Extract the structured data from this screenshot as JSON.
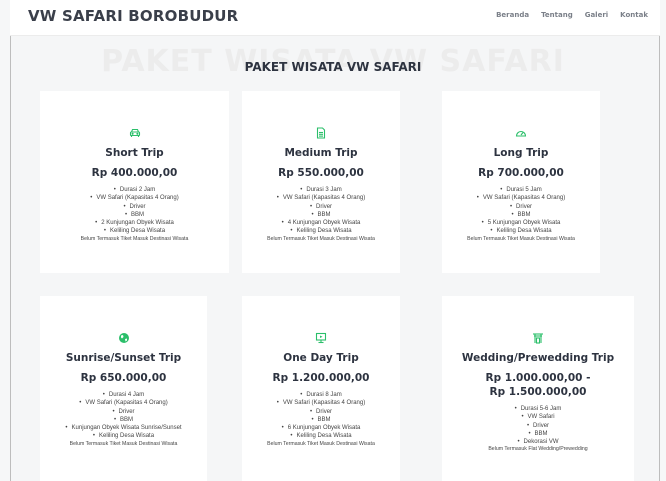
{
  "header": {
    "brand": "VW SAFARI BOROBUDUR",
    "nav": [
      "Beranda",
      "Tentang",
      "Galeri",
      "Kontak"
    ]
  },
  "section": {
    "bg_title": "PAKET WISATA VW SAFARI",
    "title": "PAKET WISATA VW SAFARI"
  },
  "theme": {
    "accent": "#2bbf6a",
    "heading": "#2d3340"
  },
  "packages": [
    {
      "icon": "car-icon",
      "title": "Short Trip",
      "price": "Rp 400.000,00",
      "features": [
        "Durasi 2 Jam",
        "VW Safari (Kapasitas 4 Orang)",
        "Driver",
        "BBM",
        "2 Kunjungan Obyek Wisata",
        "Keliling Desa Wisata"
      ],
      "note": "Belum Termasuk Tiket Masuk Destinasi Wisata"
    },
    {
      "icon": "document-icon",
      "title": "Medium Trip",
      "price": "Rp 550.000,00",
      "features": [
        "Durasi 3 Jam",
        "VW Safari (Kapasitas 4 Orang)",
        "Driver",
        "BBM",
        "4 Kunjungan Obyek Wisata",
        "Keliling Desa Wisata"
      ],
      "note": "Belum Termasuk Tiket Masuk Destinasi Wisata"
    },
    {
      "icon": "speedometer-icon",
      "title": "Long Trip",
      "price": "Rp 700.000,00",
      "features": [
        "Durasi 5 Jam",
        "VW Safari (Kapasitas 4 Orang)",
        "Driver",
        "BBM",
        "5 Kunjungan Obyek Wisata",
        "Keliling Desa Wisata"
      ],
      "note": "Belum Termasuk Tiket Masuk Destinasi Wisata"
    },
    {
      "icon": "globe-icon",
      "title": "Sunrise/Sunset Trip",
      "price": "Rp 650.000,00",
      "features": [
        "Durasi 4 Jam",
        "VW Safari (Kapasitas 4 Orang)",
        "Driver",
        "BBM",
        "Kunjungan Obyek Wisata Sunrise/Sunset",
        "Keliling Desa Wisata"
      ],
      "note": "Belum Termasuk Tiket Masuk Destinasi Wisata"
    },
    {
      "icon": "presentation-icon",
      "title": "One Day Trip",
      "price": "Rp 1.200.000,00",
      "features": [
        "Durasi 8 Jam",
        "VW Safari (Kapasitas 4 Orang)",
        "Driver",
        "BBM",
        "6 Kunjungan Obyek Wisata",
        "Keliling Desa Wisata"
      ],
      "note": "Belum Termasuk Tiket Masuk Destinasi Wisata"
    },
    {
      "icon": "gate-icon",
      "title": "Wedding/Prewedding Trip",
      "price": "Rp 1.000.000,00 - Rp 1.500.000,00",
      "features": [
        "Durasi 5-6 Jam",
        "VW Safari",
        "Driver",
        "BBM",
        "Dekorasi VW"
      ],
      "note": "Belum Termasuk Flat Wedding/Prewedding"
    }
  ]
}
